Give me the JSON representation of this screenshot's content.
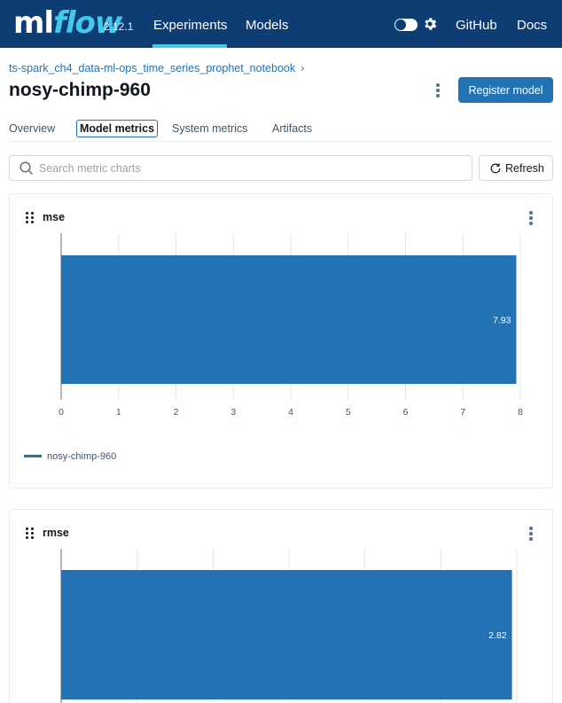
{
  "header": {
    "logo_ml": "ml",
    "logo_flow": "flow",
    "version": "2.12.1",
    "nav": {
      "experiments": "Experiments",
      "models": "Models",
      "github": "GitHub",
      "docs": "Docs"
    },
    "theme_toggle": "off",
    "accent_color": "#43c9ed",
    "bar_color": "#0e3d73"
  },
  "breadcrumb": {
    "experiment": "ts-spark_ch4_data-ml-ops_time_series_prophet_notebook",
    "separator": "›"
  },
  "run": {
    "name": "nosy-chimp-960",
    "register_label": "Register model"
  },
  "tabs": [
    "Overview",
    "Model metrics",
    "System metrics",
    "Artifacts"
  ],
  "active_tab": "Model metrics",
  "search": {
    "placeholder": "Search metric charts",
    "value": ""
  },
  "refresh_label": "Refresh",
  "icons": [
    "gear-icon",
    "search-icon",
    "refresh-icon",
    "drag-handle-icon",
    "kebab-menu-icon"
  ],
  "chart_data": [
    {
      "type": "bar",
      "orientation": "horizontal",
      "title": "mse",
      "categories": [
        "nosy-chimp-960"
      ],
      "values": [
        7.93
      ],
      "data_labels": [
        "7.93"
      ],
      "xlim": [
        0,
        8
      ],
      "xticks": [
        0,
        1,
        2,
        3,
        4,
        5,
        6,
        7,
        8
      ],
      "legend": [
        "nosy-chimp-960"
      ],
      "legend_position": "bottom-left",
      "grid": true,
      "color": "#2272b4"
    },
    {
      "type": "bar",
      "orientation": "horizontal",
      "title": "rmse",
      "categories": [
        "nosy-chimp-960"
      ],
      "values": [
        2.82
      ],
      "data_labels": [
        "2.82"
      ],
      "xlim": [
        0,
        2.85
      ],
      "grid": true,
      "color": "#2272b4"
    }
  ]
}
